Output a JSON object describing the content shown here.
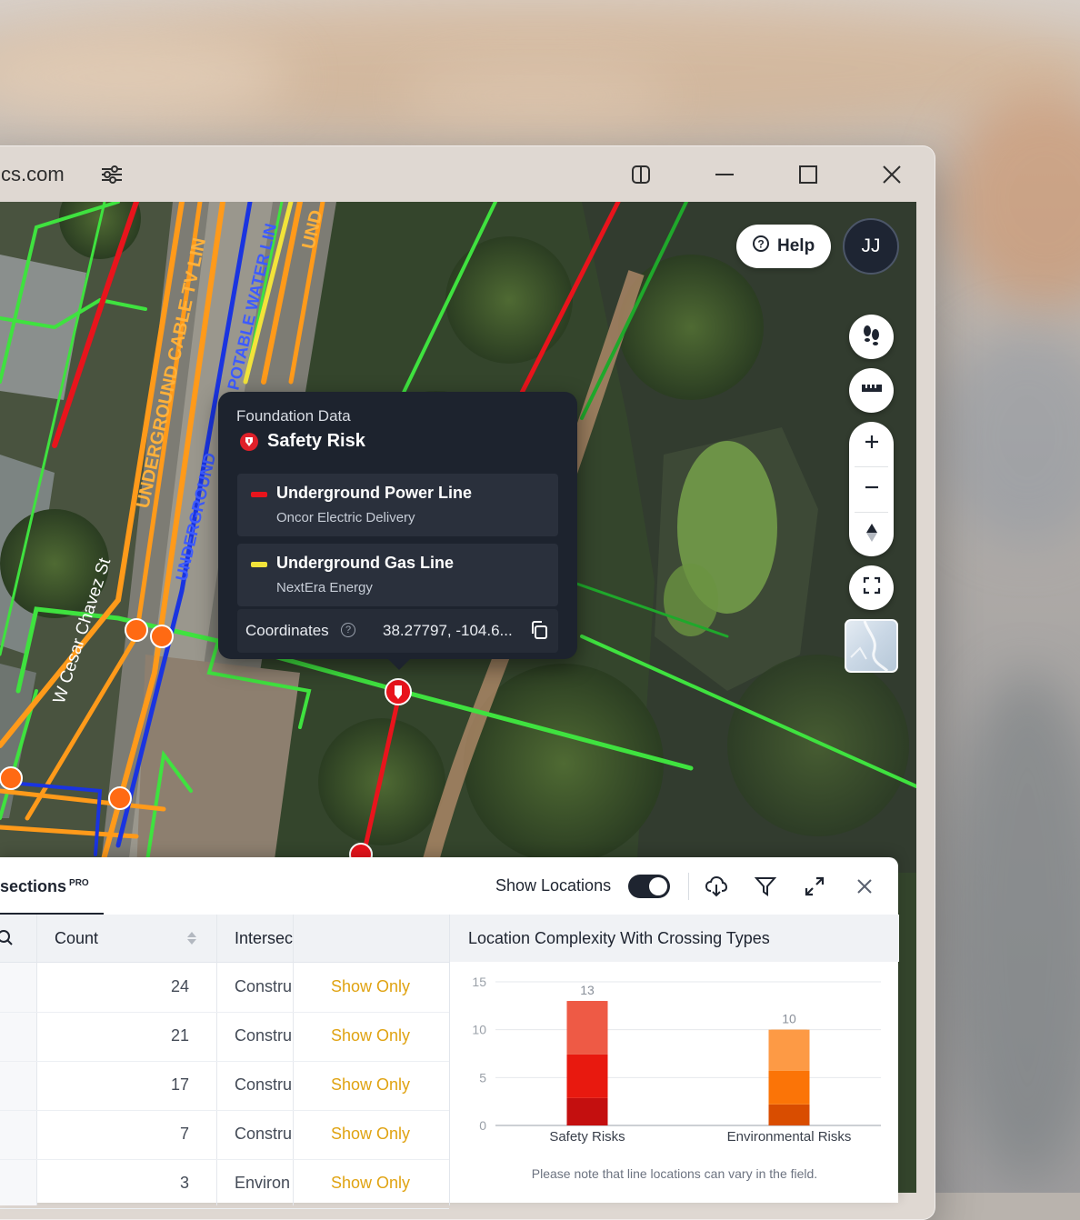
{
  "browser": {
    "url_fragment": "cs.com"
  },
  "map": {
    "help_label": "Help",
    "avatar_initials": "JJ",
    "street_labels": {
      "cable": "UNDERGROUND CABLE TV LIN",
      "water": "POTABLE WATER LIN",
      "und": "UND",
      "underground": "UNDERGROUND",
      "street": "W Cesar Chavez St"
    },
    "controls": [
      "footsteps-icon",
      "ruler-icon",
      "zoom-in-icon",
      "zoom-out-icon",
      "compass-icon",
      "fullscreen-icon",
      "minimap"
    ]
  },
  "popup": {
    "subtitle": "Foundation Data",
    "title": "Safety Risk",
    "utilities": [
      {
        "name": "Underground Power Line",
        "company": "Oncor Electric Delivery",
        "color": "#e8141c"
      },
      {
        "name": "Underground Gas Line",
        "company": "NextEra Energy",
        "color": "#f2e33a"
      }
    ],
    "coordinates_label": "Coordinates",
    "coordinates_value": "38.27797, -104.6..."
  },
  "panel": {
    "tab_label": "sections",
    "tab_badge": "PRO",
    "show_locations_label": "Show Locations",
    "show_locations_on": true,
    "columns": {
      "count": "Count",
      "intersection": "Intersec"
    },
    "rows": [
      {
        "count": "24",
        "intersection": "Constru",
        "action": "Show Only"
      },
      {
        "count": "21",
        "intersection": "Constru",
        "action": "Show Only"
      },
      {
        "count": "17",
        "intersection": "Constru",
        "action": "Show Only"
      },
      {
        "count": "7",
        "intersection": "Constru",
        "action": "Show Only"
      },
      {
        "count": "3",
        "intersection": "Environ",
        "action": "Show Only"
      }
    ],
    "chart_title": "Location Complexity With Crossing Types",
    "chart_note": "Please note that line locations can vary in the field."
  },
  "chart_data": {
    "type": "bar",
    "title": "Location Complexity With Crossing Types",
    "categories": [
      "Safety Risks",
      "Environmental Risks"
    ],
    "values": [
      13,
      10
    ],
    "ylim": [
      0,
      15
    ],
    "yticks": [
      0,
      5,
      10,
      15
    ],
    "stack_colors": [
      [
        "#c40f0f",
        "#e8190f",
        "#ee5a45"
      ],
      [
        "#d94d00",
        "#fb7407",
        "#fd9a45"
      ]
    ],
    "grid": true
  }
}
